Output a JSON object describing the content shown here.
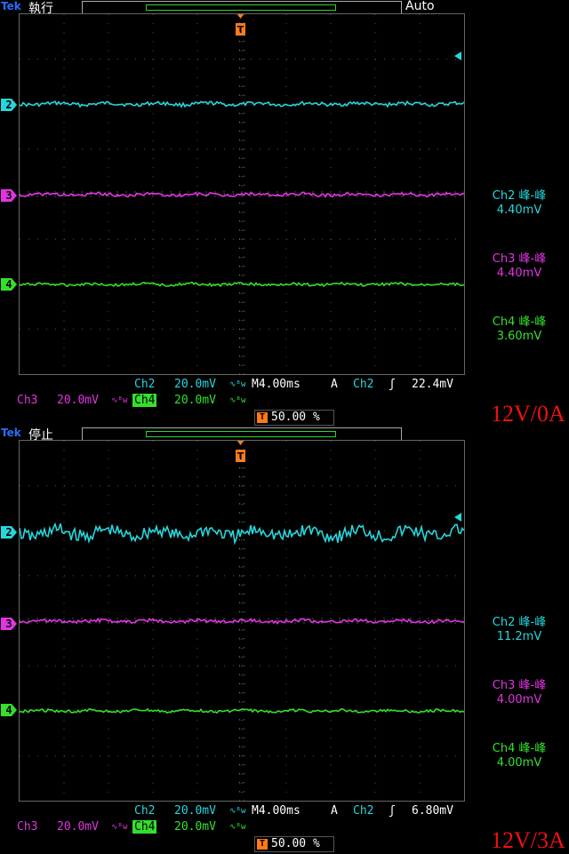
{
  "colors": {
    "ch2": "#27d6dc",
    "ch3": "#e234e2",
    "ch4": "#34e02c",
    "trigger": "#ff7a1a",
    "signature": "#e01818"
  },
  "panels": [
    {
      "brand": "Tek",
      "state": "執行",
      "mode": "Auto",
      "trigger_marker": "T",
      "channel_markers": [
        "2",
        "3",
        "4"
      ],
      "measurements": [
        {
          "label": "Ch2 峰-峰",
          "value": "4.40mV"
        },
        {
          "label": "Ch3 峰-峰",
          "value": "4.40mV"
        },
        {
          "label": "Ch4 峰-峰",
          "value": "3.60mV"
        }
      ],
      "status_row1": {
        "ch2_name": "Ch2",
        "ch2_scale": "20.0mV",
        "timebase": "M4.00ms",
        "trig_mode": "A",
        "trig_source": "Ch2",
        "trig_level": "22.4mV"
      },
      "status_row2": {
        "ch3_name": "Ch3",
        "ch3_scale": "20.0mV",
        "ch4_name": "Ch4",
        "ch4_scale": "20.0mV",
        "trig_pos_marker": "T",
        "trig_pos": "50.00 %"
      },
      "signature": "12V/0A",
      "noise": {
        "ch2": 0.04,
        "ch3": 0.035,
        "ch4": 0.03
      }
    },
    {
      "brand": "Tek",
      "state": "停止",
      "mode": "",
      "trigger_marker": "T",
      "channel_markers": [
        "2",
        "3",
        "4"
      ],
      "measurements": [
        {
          "label": "Ch2 峰-峰",
          "value": "11.2mV"
        },
        {
          "label": "Ch3 峰-峰",
          "value": "4.00mV"
        },
        {
          "label": "Ch4 峰-峰",
          "value": "4.00mV"
        }
      ],
      "status_row1": {
        "ch2_name": "Ch2",
        "ch2_scale": "20.0mV",
        "timebase": "M4.00ms",
        "trig_mode": "A",
        "trig_source": "Ch2",
        "trig_level": "6.80mV"
      },
      "status_row2": {
        "ch3_name": "Ch3",
        "ch3_scale": "20.0mV",
        "ch4_name": "Ch4",
        "ch4_scale": "20.0mV",
        "trig_pos_marker": "T",
        "trig_pos": "50.00 %"
      },
      "signature": "12V/3A",
      "noise": {
        "ch2": 0.15,
        "ch3": 0.035,
        "ch4": 0.03
      }
    }
  ]
}
